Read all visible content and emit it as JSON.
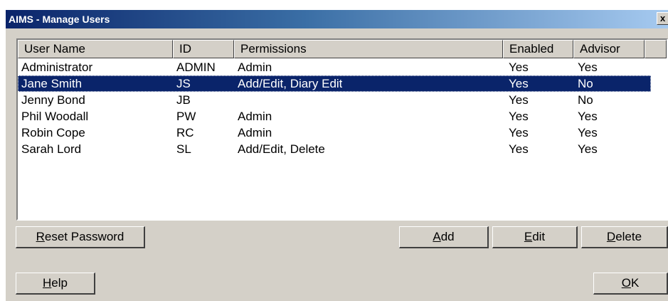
{
  "window": {
    "title": "AIMS - Manage Users",
    "close_glyph": "x"
  },
  "columns": [
    "User Name",
    "ID",
    "Permissions",
    "Enabled",
    "Advisor"
  ],
  "users": [
    {
      "name": "Administrator",
      "id": "ADMIN",
      "permissions": "Admin",
      "enabled": "Yes",
      "advisor": "Yes"
    },
    {
      "name": "Jane Smith",
      "id": "JS",
      "permissions": "Add/Edit, Diary Edit",
      "enabled": "Yes",
      "advisor": "No"
    },
    {
      "name": "Jenny Bond",
      "id": "JB",
      "permissions": "",
      "enabled": "Yes",
      "advisor": "No"
    },
    {
      "name": "Phil Woodall",
      "id": "PW",
      "permissions": "Admin",
      "enabled": "Yes",
      "advisor": "Yes"
    },
    {
      "name": "Robin Cope",
      "id": "RC",
      "permissions": "Admin",
      "enabled": "Yes",
      "advisor": "Yes"
    },
    {
      "name": "Sarah Lord",
      "id": "SL",
      "permissions": "Add/Edit, Delete",
      "enabled": "Yes",
      "advisor": "Yes"
    }
  ],
  "selected_user": "Jane Smith",
  "buttons": {
    "reset_password": {
      "mnemonic": "R",
      "rest": "eset Password"
    },
    "add": {
      "mnemonic": "A",
      "rest": "dd"
    },
    "edit": {
      "mnemonic": "E",
      "rest": "dit"
    },
    "delete": {
      "mnemonic": "D",
      "rest": "elete"
    },
    "help": {
      "mnemonic": "H",
      "rest": "elp"
    },
    "ok": {
      "mnemonic": "O",
      "rest": "K"
    }
  },
  "colors": {
    "selection": "#0a246a",
    "face": "#d4d0c8"
  }
}
